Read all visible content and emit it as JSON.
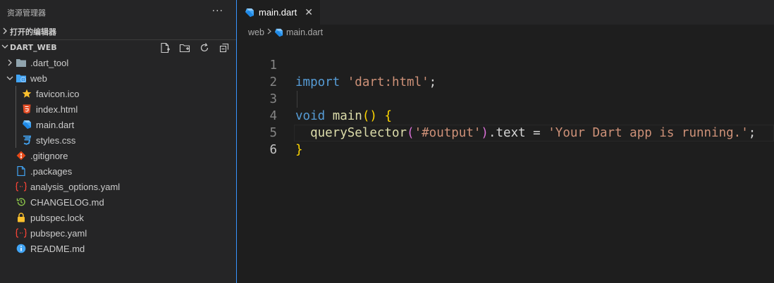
{
  "sidebar": {
    "title": "资源管理器",
    "more": "···",
    "open_editors_label": "打开的编辑器",
    "folder_label": "DART_WEB",
    "tree": [
      {
        "label": ".dart_tool",
        "icon": "folder-icon",
        "type": "folder",
        "level": 0
      },
      {
        "label": "web",
        "icon": "web-folder-icon",
        "type": "folder-open",
        "level": 0
      },
      {
        "label": "favicon.ico",
        "icon": "star-icon",
        "type": "file",
        "level": 1
      },
      {
        "label": "index.html",
        "icon": "html-icon",
        "type": "file",
        "level": 1
      },
      {
        "label": "main.dart",
        "icon": "dart-icon",
        "type": "file",
        "level": 1
      },
      {
        "label": "styles.css",
        "icon": "css-icon",
        "type": "file",
        "level": 1
      },
      {
        "label": ".gitignore",
        "icon": "git-icon",
        "type": "file",
        "level": 0
      },
      {
        "label": ".packages",
        "icon": "file-icon",
        "type": "file",
        "level": 0
      },
      {
        "label": "analysis_options.yaml",
        "icon": "yaml-icon",
        "type": "file",
        "level": 0
      },
      {
        "label": "CHANGELOG.md",
        "icon": "history-icon",
        "type": "file",
        "level": 0
      },
      {
        "label": "pubspec.lock",
        "icon": "lock-icon",
        "type": "file",
        "level": 0
      },
      {
        "label": "pubspec.yaml",
        "icon": "yaml-icon",
        "type": "file",
        "level": 0
      },
      {
        "label": "README.md",
        "icon": "info-icon",
        "type": "file",
        "level": 0
      }
    ]
  },
  "editor": {
    "tab_label": "main.dart",
    "breadcrumb": {
      "folder": "web",
      "file": "main.dart"
    },
    "line_numbers": [
      "1",
      "2",
      "3",
      "4",
      "5",
      "6"
    ],
    "code": {
      "l1_kw": "import",
      "l1_str": "'dart:html'",
      "l1_end": ";",
      "l3_kw": "void",
      "l3_fn": "main",
      "l3_paren": "()",
      "l3_brace": "{",
      "l4_fn": "querySelector",
      "l4_open": "(",
      "l4_arg": "'#output'",
      "l4_close": ")",
      "l4_mid": ".text = ",
      "l4_str": "'Your Dart app is running.'",
      "l4_end": ";",
      "l5_brace": "}"
    }
  },
  "colors": {
    "keyword": "#569cd6",
    "string": "#ce9178",
    "function": "#dcdcaa",
    "bracket_gold": "#ffd700",
    "bracket_purple": "#da70d6",
    "focus_border": "#3794ff"
  }
}
